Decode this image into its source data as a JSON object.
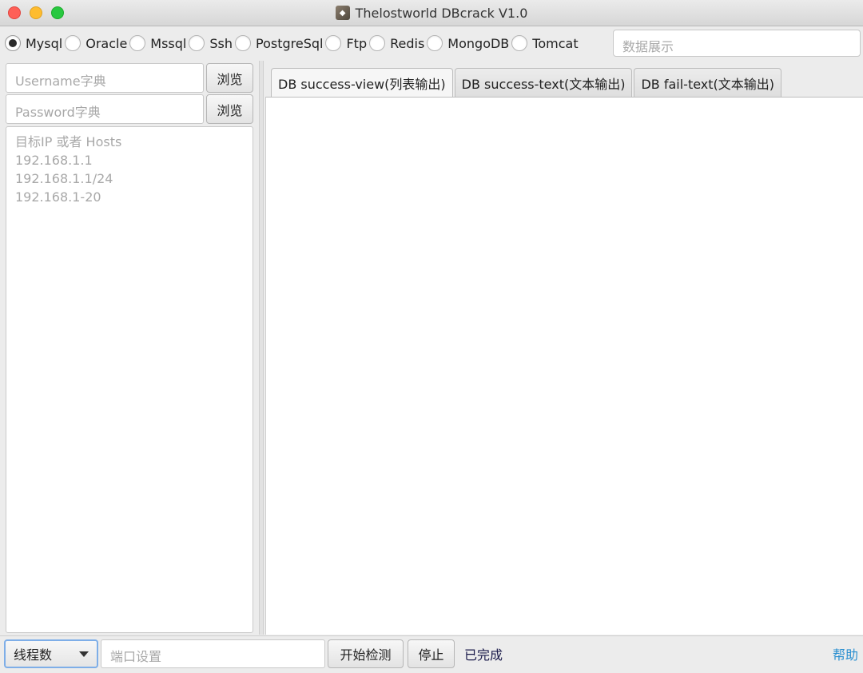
{
  "window": {
    "title": "Thelostworld DBcrack V1.0"
  },
  "db_types": [
    {
      "label": "Mysql",
      "checked": true
    },
    {
      "label": "Oracle",
      "checked": false
    },
    {
      "label": "Mssql",
      "checked": false
    },
    {
      "label": "Ssh",
      "checked": false
    },
    {
      "label": "PostgreSql",
      "checked": false
    },
    {
      "label": "Ftp",
      "checked": false
    },
    {
      "label": "Redis",
      "checked": false
    },
    {
      "label": "MongoDB",
      "checked": false
    },
    {
      "label": "Tomcat",
      "checked": false
    }
  ],
  "data_display": {
    "placeholder": "数据展示"
  },
  "left": {
    "username_placeholder": "Username字典",
    "password_placeholder": "Password字典",
    "browse_label": "浏览",
    "hosts_lines": [
      "目标IP 或者 Hosts",
      "192.168.1.1",
      "192.168.1.1/24",
      "192.168.1-20"
    ]
  },
  "tabs": [
    {
      "label": "DB success-view(列表输出)",
      "active": true
    },
    {
      "label": "DB success-text(文本输出)",
      "active": false
    },
    {
      "label": "DB fail-text(文本输出)",
      "active": false
    }
  ],
  "bottom": {
    "thread_label": "线程数",
    "port_placeholder": "端口设置",
    "start_label": "开始检测",
    "stop_label": "停止",
    "status_text": "已完成",
    "help_label": "帮助"
  },
  "colors": {
    "accent": "#7eaee8",
    "help_link": "#2a8fd0",
    "close": "#fe5f57",
    "minimize": "#febc2e",
    "maximize": "#28c840"
  }
}
